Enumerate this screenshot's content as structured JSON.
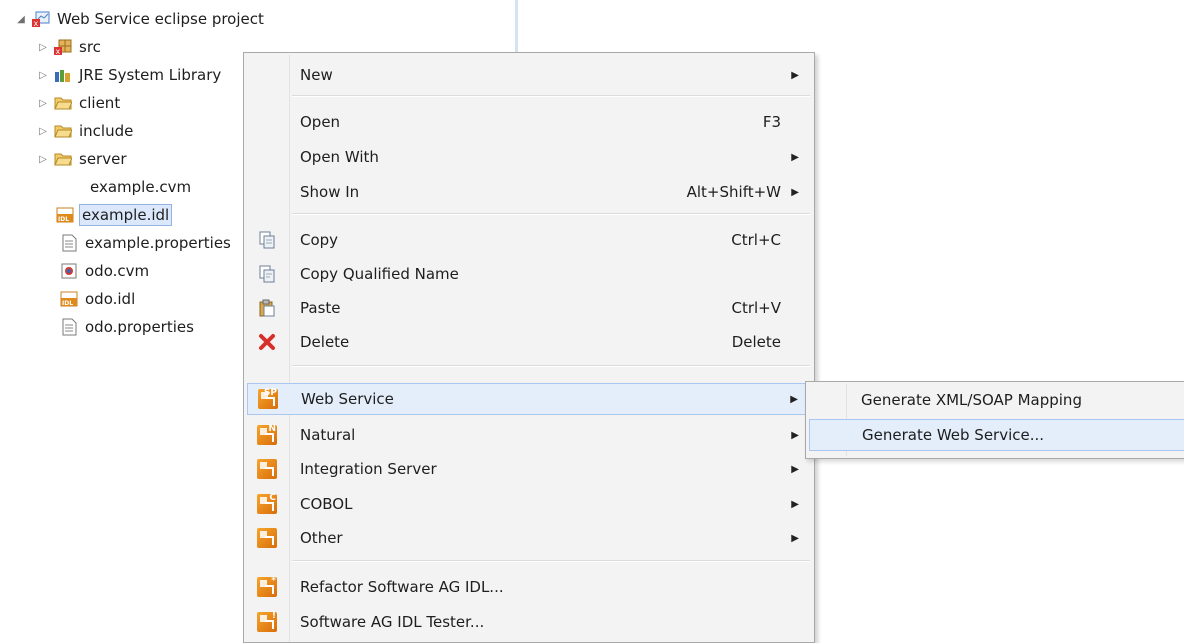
{
  "tree": {
    "project": "Web Service eclipse project",
    "items": [
      {
        "label": "src",
        "twisty": "▷"
      },
      {
        "label": "JRE System Library",
        "twisty": "▷"
      },
      {
        "label": "client",
        "twisty": "▷"
      },
      {
        "label": "include",
        "twisty": "▷"
      },
      {
        "label": "server",
        "twisty": "▷"
      },
      {
        "label": "example.cvm",
        "twisty": ""
      },
      {
        "label": "example.idl",
        "twisty": ""
      },
      {
        "label": "example.properties",
        "twisty": ""
      },
      {
        "label": "odo.cvm",
        "twisty": ""
      },
      {
        "label": "odo.idl",
        "twisty": ""
      },
      {
        "label": "odo.properties",
        "twisty": ""
      }
    ],
    "project_twisty": "◢"
  },
  "menu": {
    "new": "New",
    "open": "Open",
    "open_key": "F3",
    "open_with": "Open With",
    "show_in": "Show In",
    "show_in_key": "Alt+Shift+W",
    "copy": "Copy",
    "copy_key": "Ctrl+C",
    "copy_qualified": "Copy Qualified Name",
    "paste": "Paste",
    "paste_key": "Ctrl+V",
    "delete": "Delete",
    "delete_key": "Delete",
    "web_service": "Web Service",
    "natural": "Natural",
    "integration_server": "Integration Server",
    "cobol": "COBOL",
    "other": "Other",
    "refactor": "Refactor Software AG IDL...",
    "tester": "Software AG IDL Tester...",
    "arrow": "▶"
  },
  "submenu": {
    "gen_mapping": "Generate XML/SOAP Mapping",
    "gen_service": "Generate Web Service..."
  },
  "colors": {
    "accent_orange": "#e8870f",
    "hover_bg": "#e4eefb",
    "hover_border": "#aac8ef",
    "selection": "#dbe8fb"
  }
}
